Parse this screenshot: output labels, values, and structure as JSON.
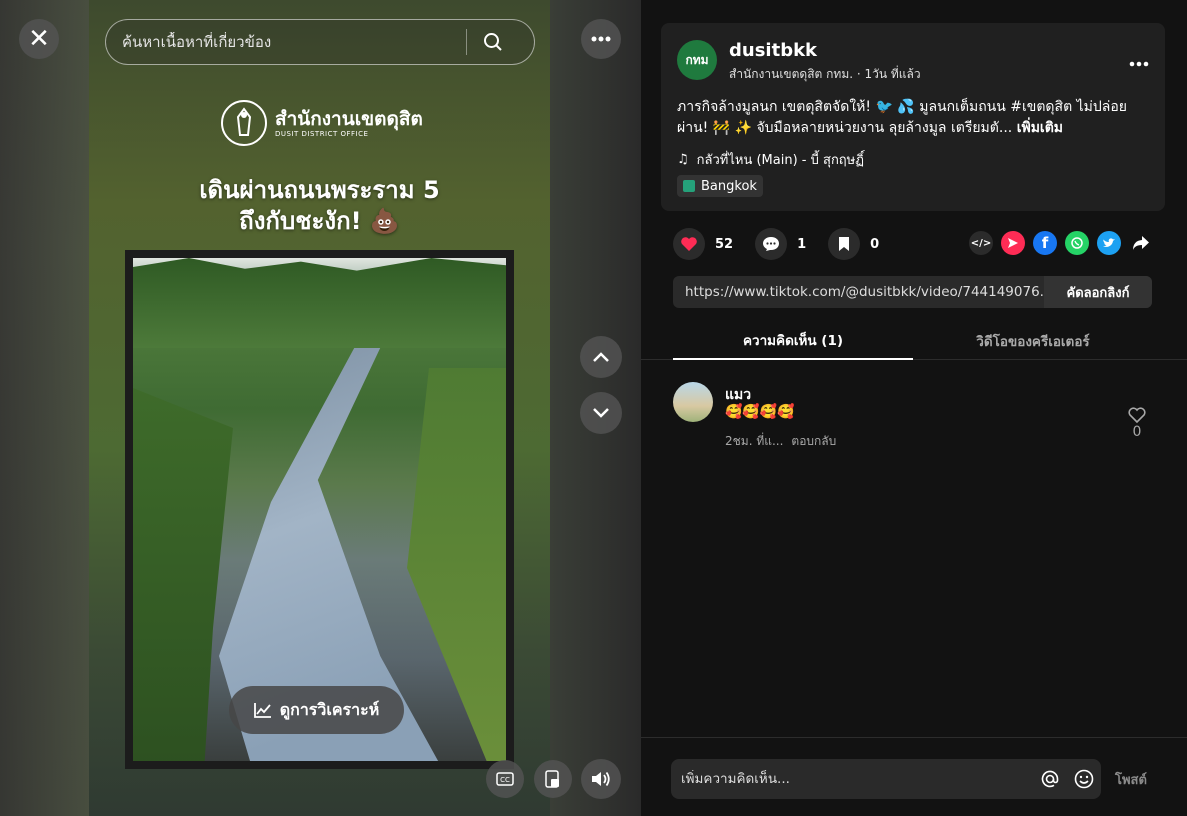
{
  "video": {
    "search_placeholder": "ค้นหาเนื้อหาที่เกี่ยวข้อง",
    "logo_title": "สำนักงานเขตดุสิต",
    "logo_subtitle": "DUSIT DISTRICT OFFICE",
    "headline_line1": "เดินผ่านถนนพระราม 5",
    "headline_line2": "ถึงกับชะงัก! 💩",
    "analysis_button": "ดูการวิเคราะห์",
    "cc_label": "CC"
  },
  "post": {
    "avatar_text": "กทม",
    "username": "dusitbkk",
    "subtitle": "สำนักงานเขตดุสิต กทม. · 1วัน ที่แล้ว",
    "caption": "ภารกิจล้างมูลนก เขตดุสิตจัดให้! 🐦 💦 มูลนกเต็มถนน #เขตดุสิต ไม่ปล่อยผ่าน! 🚧 ✨ จับมือหลายหน่วยงาน ลุยล้างมูล เตรียมตั...",
    "more_link": "เพิ่มเติม",
    "music": "กลัวที่ไหน (Main) - บี้ สุกฤษฏิ์",
    "location": "Bangkok"
  },
  "stats": {
    "likes": "52",
    "comments": "1",
    "saves": "0"
  },
  "share": {
    "url": "https://www.tiktok.com/@dusitbkk/video/744149076...",
    "copy_label": "คัดลอกลิงก์"
  },
  "tabs": {
    "comments": "ความคิดเห็น (1)",
    "creator_videos": "วิดีโอของครีเอเตอร์"
  },
  "comment": {
    "name": "แมว",
    "text": "🥰🥰🥰🥰",
    "time": "2ชม. ที่แ...",
    "reply": "ตอบกลับ",
    "likes": "0"
  },
  "composer": {
    "placeholder": "เพิ่มความคิดเห็น...",
    "post_label": "โพสต์"
  },
  "colors": {
    "like_red": "#fe2c55",
    "facebook": "#1877f2",
    "whatsapp": "#25d366",
    "twitter": "#1da1f2",
    "avatar_green": "#1f7a3e"
  }
}
